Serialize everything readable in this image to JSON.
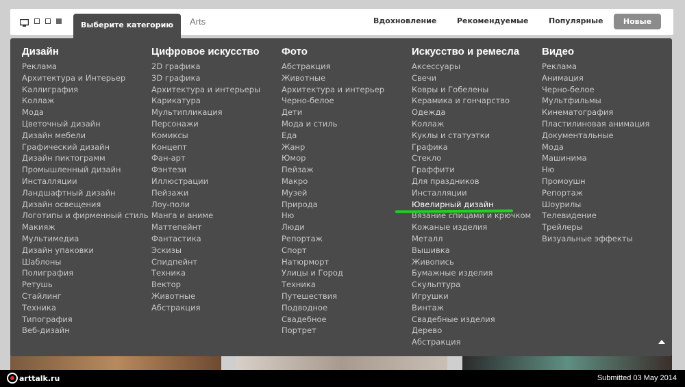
{
  "topbar": {
    "category_tab": "Выберите категорию",
    "arts_tab": "Arts",
    "nav": [
      "Вдохновление",
      "Рекомендуемые",
      "Популярные"
    ],
    "nav_active": "Новые",
    "view_icons": [
      "monitor-icon",
      "grid-small-icon",
      "grid-medium-icon",
      "grid-large-icon"
    ]
  },
  "columns": [
    {
      "title": "Дизайн",
      "items": [
        "Реклама",
        "Архитектура и Интерьер",
        "Каллиграфия",
        "Коллаж",
        "Мода",
        "Цветочный дизайн",
        "Дизайн мебели",
        "Графический дизайн",
        "Дизайн пиктограмм",
        "Промышленный дизайн",
        "Инсталляции",
        "Ландшафтный дизайн",
        "Дизайн освещения",
        "Логотипы и фирменный стиль",
        "Макияж",
        "Мультимедиа",
        "Дизайн упаковки",
        "Шаблоны",
        "Полиграфия",
        "Ретушь",
        "Стайлинг",
        "Техника",
        "Типография",
        "Веб-дизайн"
      ]
    },
    {
      "title": "Цифровое искусство",
      "items": [
        "2D графика",
        "3D графика",
        "Архитектура и интерьеры",
        "Карикатура",
        "Мультипликация",
        "Персонажи",
        "Комиксы",
        "Концепт",
        "Фан-арт",
        "Фэнтези",
        "Иллюстрации",
        "Пейзажи",
        "Лоу-поли",
        "Манга и аниме",
        "Маттепейнт",
        "Фантастика",
        "Эскизы",
        "Спидпейнт",
        "Техника",
        "Вектор",
        "Животные",
        "Абстракция"
      ]
    },
    {
      "title": "Фото",
      "items": [
        "Абстракция",
        "Животные",
        "Архитектура и интерьер",
        "Черно-белое",
        "Дети",
        "Мода и стиль",
        "Еда",
        "Жанр",
        "Юмор",
        "Пейзаж",
        "Макро",
        "Музей",
        "Природа",
        "Ню",
        "Люди",
        "Репортаж",
        "Спорт",
        "Натюрморт",
        "Улицы и Город",
        "Техника",
        "Путешествия",
        "Подводное",
        "Свадебное",
        "Портрет"
      ]
    },
    {
      "title": "Искусство и ремесла",
      "items": [
        "Аксессуары",
        "Свечи",
        "Ковры и Гобелены",
        "Керамика и гончарство",
        "Одежда",
        "Коллаж",
        "Куклы и статуэтки",
        "Графика",
        "Стекло",
        "Граффити",
        "Для праздников",
        "Инсталляции",
        "Ювелирный дизайн",
        "Вязание спицами и крючком",
        "Кожаные изделия",
        "Металл",
        "Вышивка",
        "Живопись",
        "Бумажные изделия",
        "Скульптура",
        "Игрушки",
        "Винтаж",
        "Свадебные изделия",
        "Дерево",
        "Абстракция"
      ],
      "highlighted": "Ювелирный дизайн"
    },
    {
      "title": "Видео",
      "items": [
        "Реклама",
        "Анимация",
        "Черно-белое",
        "Мультфильмы",
        "Кинематография",
        "Пластилиновая анимация",
        "Документальные",
        "Мода",
        "Машинима",
        "Ню",
        "Промоушн",
        "Репортаж",
        "Шоурилы",
        "Телевидение",
        "Трейлеры",
        "Визуальные эффекты"
      ]
    }
  ],
  "footer": {
    "logo_text": "arttalk.ru",
    "submitted": "Submitted 03 May 2014"
  },
  "colors": {
    "panel": "#4a4a4a",
    "highlight_underline": "#1ed31e",
    "nav_active_bg": "#8c8c8c"
  }
}
